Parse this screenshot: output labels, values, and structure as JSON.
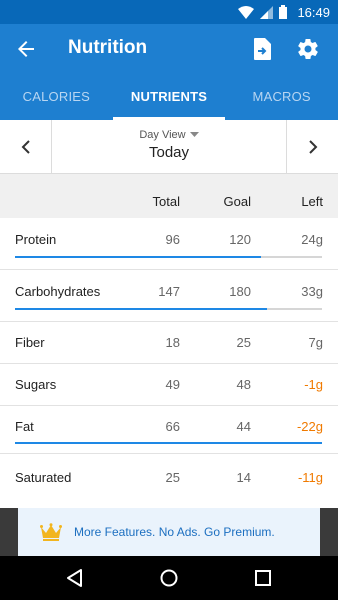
{
  "status_bar": {
    "time": "16:49",
    "icons": [
      "wifi-icon",
      "signal-icon",
      "battery-icon"
    ]
  },
  "app_bar": {
    "title": "Nutrition",
    "icons": [
      "back-arrow-icon",
      "export-file-icon",
      "gear-icon"
    ]
  },
  "tabs": [
    {
      "label": "CALORIES",
      "active": false
    },
    {
      "label": "NUTRIENTS",
      "active": true
    },
    {
      "label": "MACROS",
      "active": false
    }
  ],
  "day_nav": {
    "view_label": "Day View",
    "date_label": "Today"
  },
  "columns": {
    "total": "Total",
    "goal": "Goal",
    "left": "Left"
  },
  "nutrients": [
    {
      "name": "Protein",
      "total": "96",
      "goal": "120",
      "left": "24g",
      "progress": 0.8,
      "over": false
    },
    {
      "name": "Carbohydrates",
      "total": "147",
      "goal": "180",
      "left": "33g",
      "progress": 0.82,
      "over": false
    },
    {
      "name": "Fiber",
      "total": "18",
      "goal": "25",
      "left": "7g"
    },
    {
      "name": "Sugars",
      "total": "49",
      "goal": "48",
      "left": "-1g"
    },
    {
      "name": "Fat",
      "total": "66",
      "goal": "44",
      "left": "-22g",
      "progress": 1.0,
      "over": true
    },
    {
      "name": "Saturated",
      "total": "25",
      "goal": "14",
      "left": "-11g"
    }
  ],
  "promo": {
    "text": "More Features. No Ads. Go Premium.",
    "icon": "crown-icon"
  },
  "colors": {
    "primary": "#1e7fd0",
    "status_bar": "#0868b8",
    "progress": "#1e88e5",
    "negative": "#f07a00",
    "promo_text": "#1c6fc0"
  }
}
